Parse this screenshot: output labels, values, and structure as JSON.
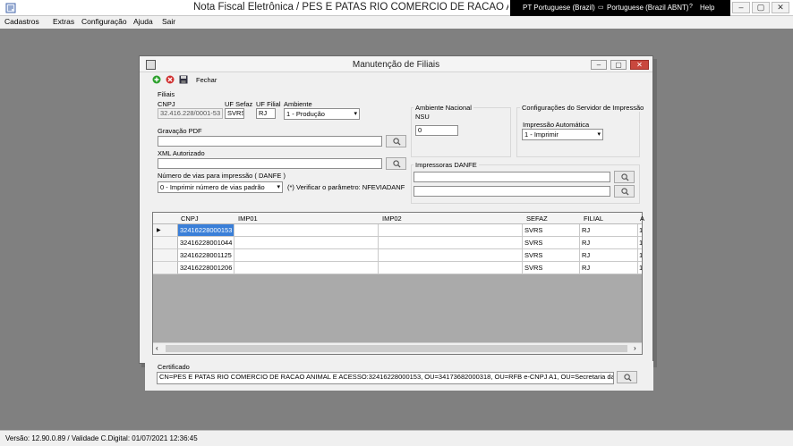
{
  "window": {
    "title": "Nota Fiscal Eletrônica / PES E PATAS RIO COMERCIO DE RACAO ANIMAL E ACESSORIOS LTDA",
    "lang_items": [
      "PT Portuguese (Brazil)",
      "Portuguese (Brazil ABNT)",
      "Help"
    ],
    "controls": {
      "minimize": "–",
      "maximize": "▢",
      "close": "✕"
    }
  },
  "menu": {
    "items": [
      "Cadastros",
      "Extras",
      "Configuração",
      "Ajuda",
      "Sair"
    ]
  },
  "dialog": {
    "title": "Manutenção de Filiais",
    "toolbar": {
      "close_label": "Fechar"
    },
    "controls": {
      "minimize": "–",
      "maximize": "▢",
      "close": "✕"
    },
    "filiais": {
      "group_label": "Filiais",
      "cnpj_label": "CNPJ",
      "cnpj_value": "32.416.228/0001-53",
      "uf_sefaz_label": "UF Sefaz",
      "uf_sefaz_value": "SVRS",
      "uf_filial_label": "UF Filial",
      "uf_filial_value": "RJ",
      "ambiente_label": "Ambiente",
      "ambiente_value": "1 - Produção",
      "gravacao_label": "Gravação PDF",
      "gravacao_value": "",
      "xml_label": "XML Autorizado",
      "xml_value": "",
      "vias_label": "Número de vias para impressão ( DANFE )",
      "vias_value": "0 - Imprimir número de vias padrão",
      "vias_note": "(*) Verificar o parâmetro: NFEVIADANF"
    },
    "ambiente_nacional": {
      "group_label": "Ambiente Nacional",
      "nsu_label": "NSU",
      "nsu_value": "0"
    },
    "servidor": {
      "group_label": "Configurações do Servidor de Impressão",
      "impressao_label": "Impressão Automática",
      "impressao_value": "1 - Imprimir"
    },
    "impressoras": {
      "group_label": "Impressoras DANFE",
      "printer1": "",
      "printer2": ""
    },
    "grid": {
      "columns": [
        "CNPJ",
        "IMP01",
        "IMP02",
        "SEFAZ",
        "FILIAL",
        "A"
      ],
      "rows": [
        {
          "cnpj": "32416228000153",
          "imp01": "",
          "imp02": "",
          "sefaz": "SVRS",
          "filial": "RJ",
          "extra": "1"
        },
        {
          "cnpj": "32416228001044",
          "imp01": "",
          "imp02": "",
          "sefaz": "SVRS",
          "filial": "RJ",
          "extra": "1"
        },
        {
          "cnpj": "32416228001125",
          "imp01": "",
          "imp02": "",
          "sefaz": "SVRS",
          "filial": "RJ",
          "extra": "1"
        },
        {
          "cnpj": "32416228001206",
          "imp01": "",
          "imp02": "",
          "sefaz": "SVRS",
          "filial": "RJ",
          "extra": "1"
        }
      ],
      "current_row_marker": "▶"
    },
    "certificado": {
      "label": "Certificado",
      "value": "CN=PES E PATAS RIO COMERCIO DE RACAO ANIMAL E ACESSO:32416228000153, OU=34173682000318, OU=RFB e-CNPJ A1, OU=Secretaria da Receita Fede"
    }
  },
  "status": {
    "text": "Versão: 12.90.0.89 / Validade C.Digital: 01/07/2021 12:36:45"
  },
  "colors": {
    "workspace": "#808080",
    "selected_cell": "#3a7fd8",
    "save_icon": "#2ca02c",
    "cancel_icon": "#d03030",
    "close_button": "#c9483e"
  }
}
